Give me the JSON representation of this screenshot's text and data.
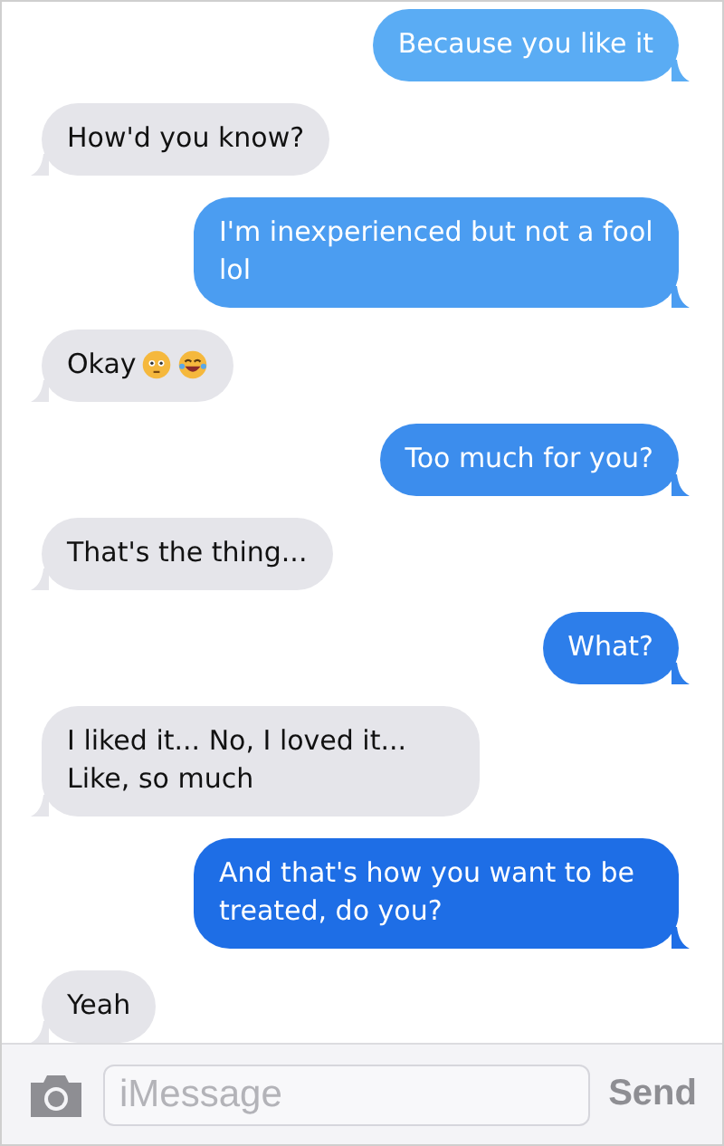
{
  "messages": [
    {
      "kind": "sent",
      "text": "Because you like it"
    },
    {
      "kind": "received",
      "text": "How'd you know?"
    },
    {
      "kind": "sent",
      "text": "I'm inexperienced but not a fool lol"
    },
    {
      "kind": "received",
      "text": "Okay",
      "emoji": [
        {
          "kind": "flushed"
        },
        {
          "kind": "laughing"
        }
      ]
    },
    {
      "kind": "sent",
      "text": "Too much for you?"
    },
    {
      "kind": "received",
      "text": "That's the thing..."
    },
    {
      "kind": "sent",
      "text": "What?"
    },
    {
      "kind": "received",
      "text": "I liked it... No, I loved it... Like, so much"
    },
    {
      "kind": "sent",
      "text": "And that's how you want to be treated, do you?"
    },
    {
      "kind": "received",
      "text": "Yeah"
    }
  ],
  "composer": {
    "placeholder": "iMessage",
    "send": "Send"
  }
}
